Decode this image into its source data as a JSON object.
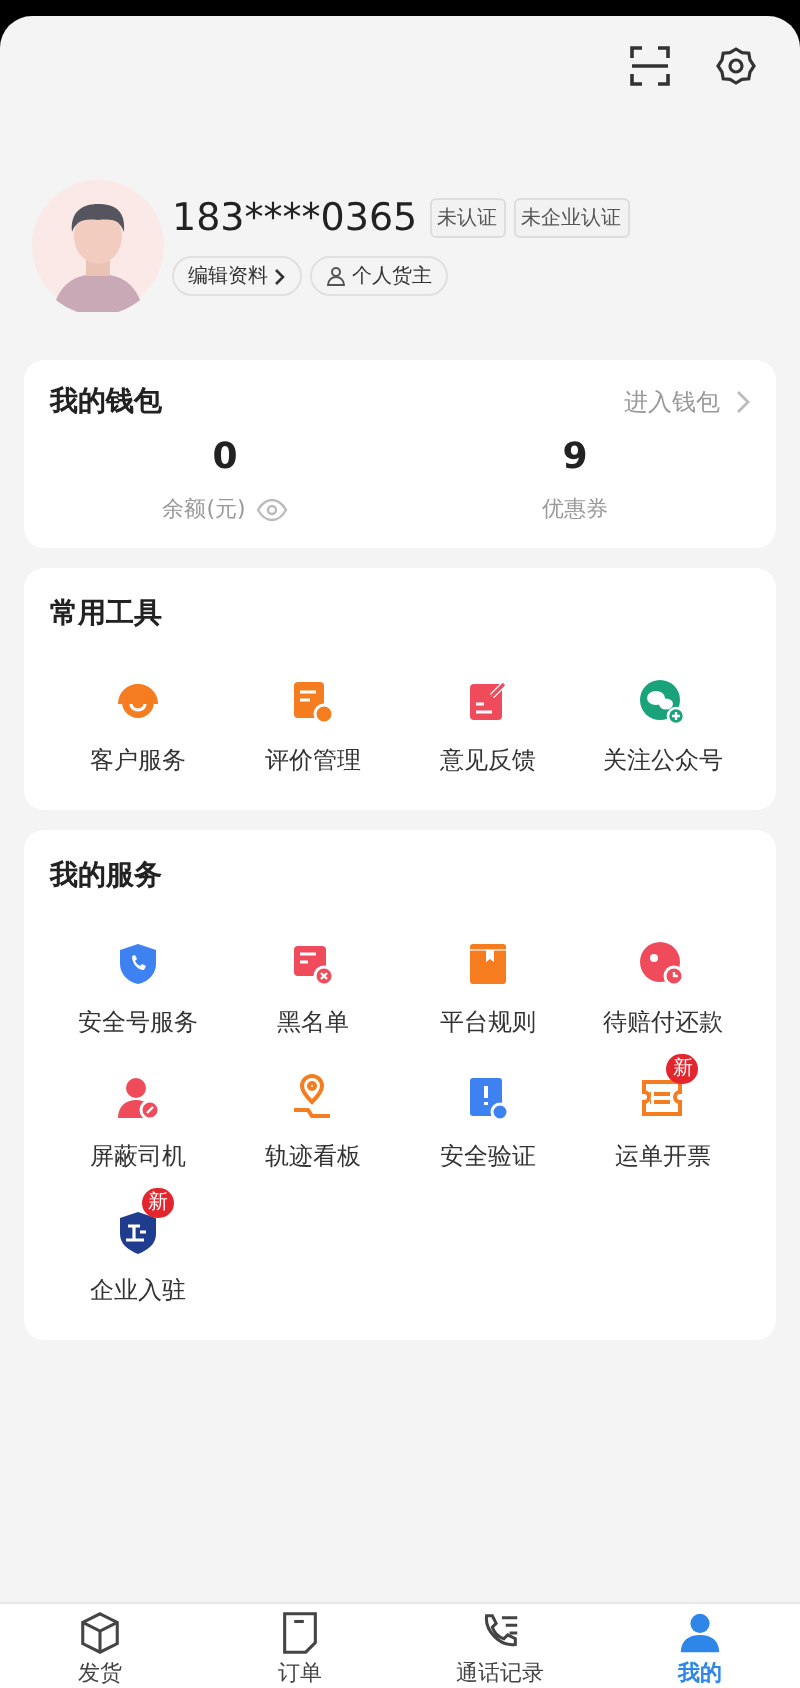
{
  "profile": {
    "phone": "183****0365",
    "tags": [
      "未认证",
      "未企业认证"
    ],
    "edit_button": "编辑资料",
    "role": "个人货主"
  },
  "wallet": {
    "title": "我的钱包",
    "link": "进入钱包",
    "stats": [
      {
        "value": "0",
        "label": "余额(元)",
        "kind": "balance"
      },
      {
        "value": "9",
        "label": "优惠券",
        "kind": "plain"
      }
    ]
  },
  "tools": {
    "title": "常用工具",
    "items": [
      {
        "label": "客户服务",
        "kind": "headset",
        "color": "#f57c1f"
      },
      {
        "label": "评价管理",
        "kind": "note",
        "color": "#f57c1f"
      },
      {
        "label": "意见反馈",
        "kind": "feedback",
        "color": "#f04b5a"
      },
      {
        "label": "关注公众号",
        "kind": "chat",
        "color": "#1aa37a"
      }
    ]
  },
  "services": {
    "title": "我的服务",
    "items": [
      {
        "label": "安全号服务",
        "kind": "shield-phone",
        "color": "#3d82f0"
      },
      {
        "label": "黑名单",
        "kind": "card-x",
        "color": "#f04b5a"
      },
      {
        "label": "平台规则",
        "kind": "book",
        "color": "#f57c1f"
      },
      {
        "label": "待赔付还款",
        "kind": "clock-circle",
        "color": "#f04b5a"
      },
      {
        "label": "屏蔽司机",
        "kind": "person-block",
        "color": "#f04b5a"
      },
      {
        "label": "轨迹看板",
        "kind": "pin",
        "color": "#f57c1f"
      },
      {
        "label": "安全验证",
        "kind": "alert",
        "color": "#3d82f0"
      },
      {
        "label": "运单开票",
        "kind": "ticket",
        "color": "#f57c1f",
        "badge": "新"
      },
      {
        "label": "企业入驻",
        "kind": "enterprise",
        "color": "#1f3c8f",
        "badge": "新"
      }
    ]
  },
  "tab_bar": [
    {
      "label": "发货",
      "kind": "box",
      "selected": false
    },
    {
      "label": "订单",
      "kind": "order",
      "selected": false
    },
    {
      "label": "通话记录",
      "kind": "call",
      "selected": false
    },
    {
      "label": "我的",
      "kind": "person",
      "selected": true
    }
  ]
}
